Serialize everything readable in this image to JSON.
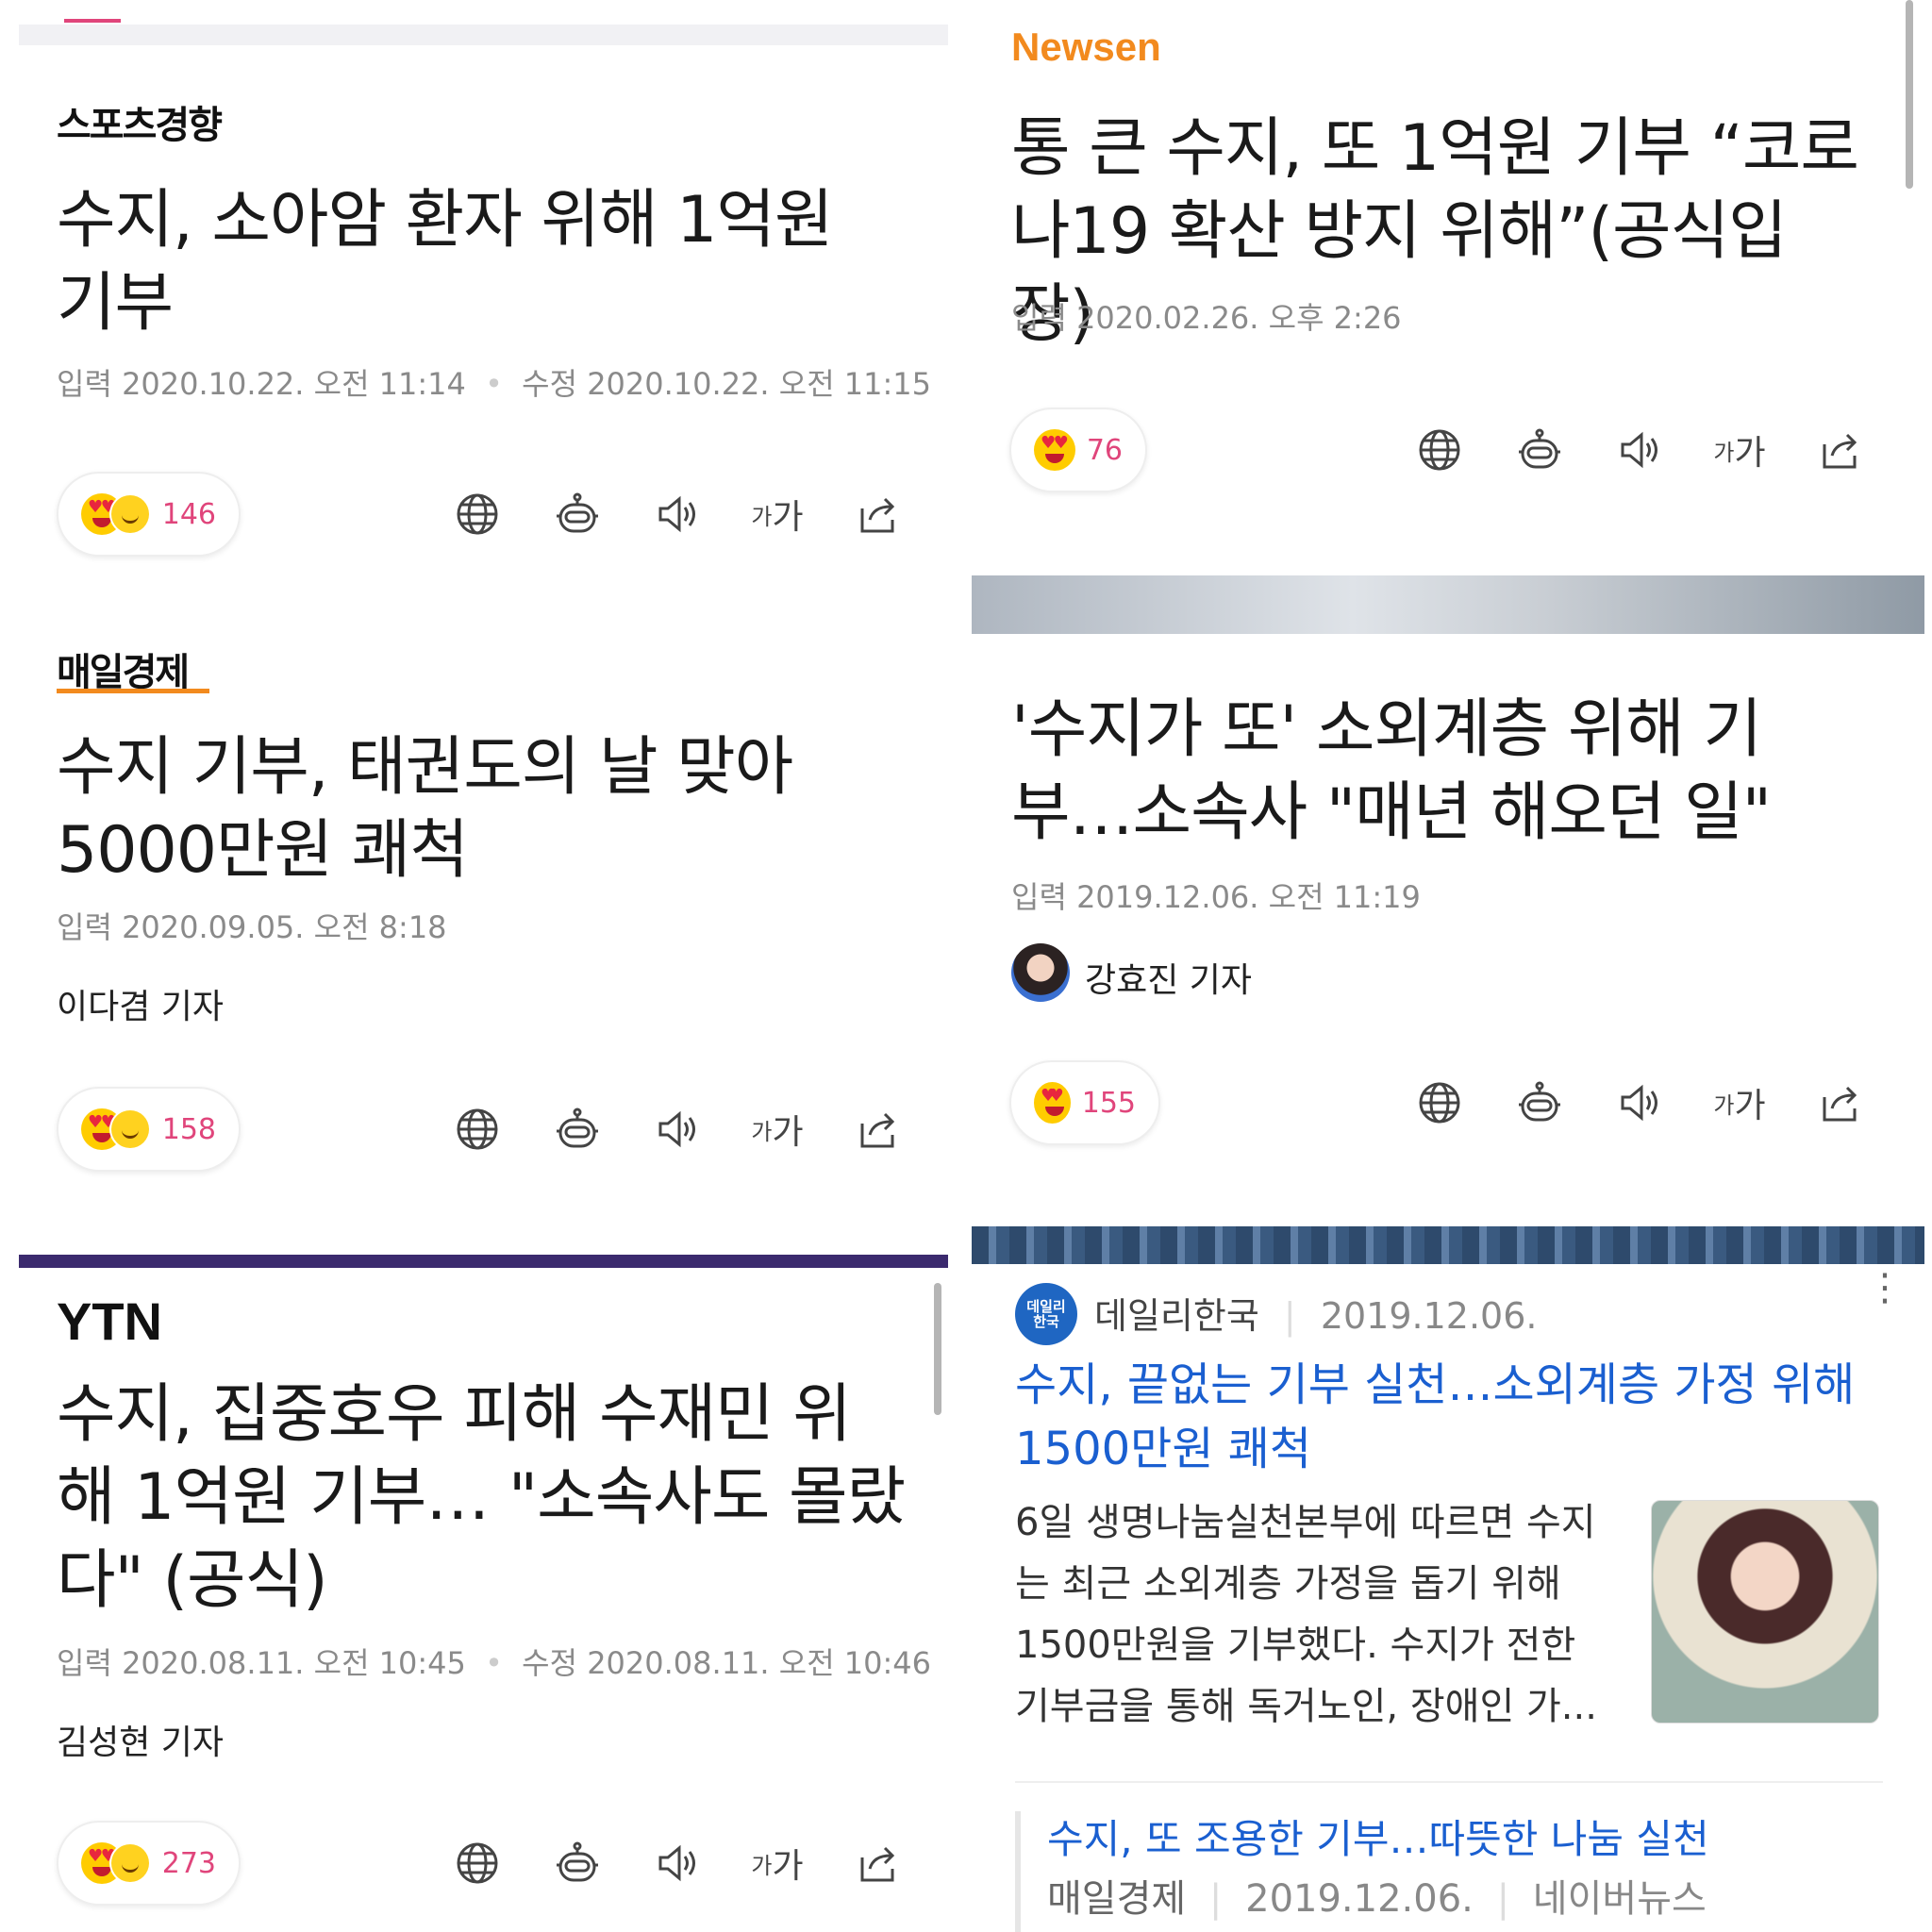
{
  "articles": [
    {
      "source": "스포츠경향",
      "title": "수지, 소아암 환자 위해 1억원 기부",
      "input_label": "입력",
      "input_date": "2020.10.22. 오전 11:14",
      "edit_label": "수정",
      "edit_date": "2020.10.22. 오전 11:15",
      "reactions": "146"
    },
    {
      "source": "매일경제",
      "title": "수지 기부, 태권도의 날 맞아 5000만원 쾌척",
      "input_label": "입력",
      "input_date": "2020.09.05. 오전 8:18",
      "reporter": "이다겸 기자",
      "reactions": "158"
    },
    {
      "source": "YTN",
      "title": "수지, 집중호우 피해 수재민 위해 1억원 기부… \"소속사도 몰랐다\" (공식)",
      "input_label": "입력",
      "input_date": "2020.08.11. 오전 10:45",
      "edit_label": "수정",
      "edit_date": "2020.08.11. 오전 10:46",
      "reporter": "김성현 기자",
      "reactions": "273"
    },
    {
      "source": "Newsen",
      "title": "통 큰 수지, 또 1억원 기부 “코로나19 확산 방지 위해”(공식입장)",
      "input_label": "입력",
      "input_date": "2020.02.26. 오후 2:26",
      "reactions": "76"
    },
    {
      "title": "'수지가 또' 소외계층 위해 기부…소속사 \"매년 해오던 일\"",
      "input_label": "입력",
      "input_date": "2019.12.06. 오전 11:19",
      "reporter": "강효진 기자",
      "reactions": "155"
    }
  ],
  "tool_labels": {
    "font": "가가"
  },
  "search_result": {
    "source_logo": "데일리 한국",
    "source": "데일리한국",
    "date": "2019.12.06.",
    "title": "수지, 끝없는 기부 실천…소외계층 가정 위해 1500만원 쾌척",
    "snippet": "6일 생명나눔실천본부에 따르면 수지는 최근 소외계층 가정을 돕기 위해 1500만원을 기부했다. 수지가 전한 기부금을 통해 독거노인, 장애인 가...",
    "related_title": "수지, 또 조용한 기부…따뜻한 나눔 실천",
    "related_source": "매일경제",
    "related_date": "2019.12.06.",
    "related_platform": "네이버뉴스"
  },
  "colors": {
    "link_blue": "#1a5fd0",
    "reaction_pink": "#e0457b",
    "newsen_orange": "#f28a1e"
  }
}
